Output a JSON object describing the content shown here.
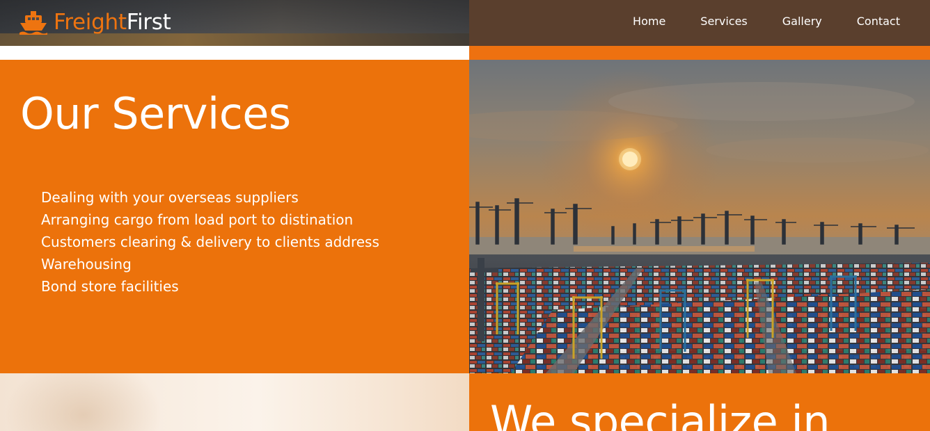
{
  "brand": {
    "name_part1": "Freight",
    "name_part2": "First",
    "icon": "ship-icon",
    "accent_color": "#ee7410"
  },
  "nav": {
    "items": [
      {
        "label": "Home"
      },
      {
        "label": "Services"
      },
      {
        "label": "Gallery"
      },
      {
        "label": "Contact"
      }
    ]
  },
  "services": {
    "title": "Our Services",
    "items": [
      "Dealing with your overseas suppliers",
      "Arranging cargo from load port to distination",
      "Customers clearing & delivery to clients address",
      "Warehousing",
      "Bond store facilities"
    ]
  },
  "specialize": {
    "title": "We specialize in"
  },
  "colors": {
    "primary_orange": "#ec720b",
    "header_brown": "#5a3f2d",
    "text_white": "#ffffff"
  }
}
